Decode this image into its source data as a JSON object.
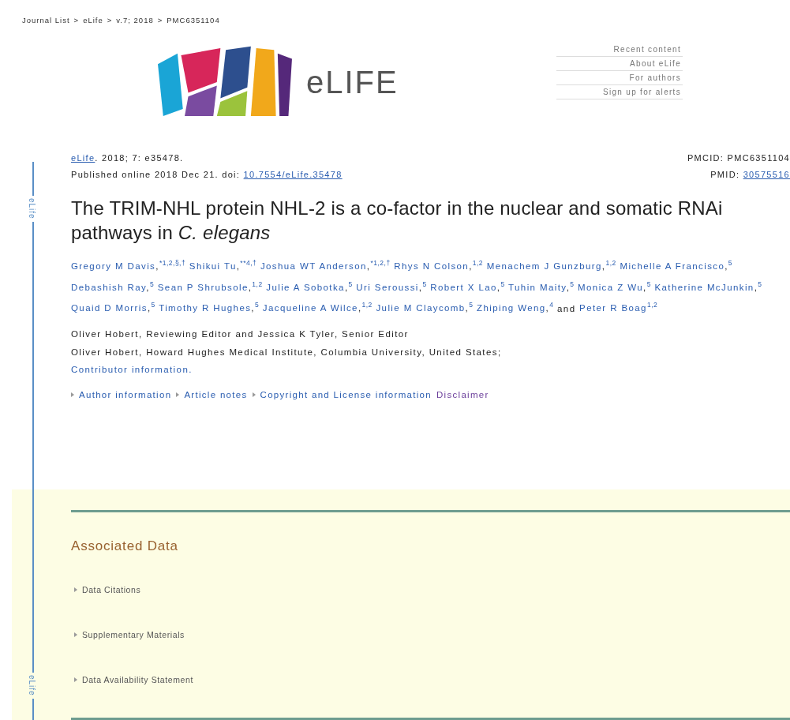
{
  "breadcrumb": [
    {
      "text": "Journal List",
      "sep": ">"
    },
    {
      "text": "eLife",
      "sep": ">"
    },
    {
      "text": "v.7; 2018",
      "sep": ">"
    },
    {
      "text": "PMC6351104"
    }
  ],
  "logo": {
    "text": "eLIFE"
  },
  "nav": [
    "Recent content",
    "About eLife",
    "For authors",
    "Sign up for alerts"
  ],
  "sidebar_label": [
    "eLife",
    "eLife"
  ],
  "citation": {
    "journal": "eLife",
    "rest": ". 2018; 7: e35478.",
    "published": "Published online 2018 Dec 21. doi: ",
    "doi": "10.7554/eLife.35478",
    "pmcid": "PMCID: PMC6351104",
    "pmid_label": "PMID: ",
    "pmid": "30575516"
  },
  "title": "The TRIM-NHL protein NHL-2 is a co-factor in the nuclear and somatic RNAi pathways in *C. elegans*",
  "authors": [
    {
      "name": "Gregory M Davis",
      "after": ",",
      "sup": "*1,2,§,†"
    },
    {
      "name": "Shikui Tu",
      "after": ",",
      "sup": "**4,†"
    },
    {
      "name": "Joshua WT Anderson",
      "after": ",",
      "sup": "*1,2,†"
    },
    {
      "name": "Rhys N Colson",
      "after": ",",
      "sup": "1,2"
    },
    {
      "name": "Menachem J Gunzburg",
      "after": ",",
      "sup": "1,2"
    },
    {
      "name": "Michelle A Francisco",
      "after": ",",
      "sup": "5"
    },
    {
      "name": "Debashish Ray",
      "after": ",",
      "sup": "5"
    },
    {
      "name": "Sean P Shrubsole",
      "after": ",",
      "sup": "1,2"
    },
    {
      "name": "Julie A Sobotka",
      "after": ",",
      "sup": "5"
    },
    {
      "name": "Uri Seroussi",
      "after": ",",
      "sup": "5"
    },
    {
      "name": "Robert X Lao",
      "after": ",",
      "sup": "5"
    },
    {
      "name": "Tuhin Maity",
      "after": ",",
      "sup": "5"
    },
    {
      "name": "Monica Z Wu",
      "after": ",",
      "sup": "5"
    },
    {
      "name": "Katherine McJunkin",
      "after": ",",
      "sup": "5"
    },
    {
      "name": "Quaid D Morris",
      "after": ",",
      "sup": "5"
    },
    {
      "name": "Timothy R Hughes",
      "after": ",",
      "sup": "5"
    },
    {
      "name": "Jacqueline A Wilce",
      "after": ",",
      "sup": "1,2"
    },
    {
      "name": "Julie M Claycomb",
      "after": ",",
      "sup": "5"
    },
    {
      "name": "Zhiping Weng",
      "after": ",",
      "sup": "4"
    },
    {
      "name": "Peter R Boag",
      "sup": "1,2",
      "prefix": "and"
    }
  ],
  "editors": [
    "Oliver Hobert, Reviewing Editor and Jessica K Tyler, Senior Editor",
    "Oliver Hobert, Howard Hughes Medical Institute, Columbia University, United States;"
  ],
  "contributor_link": "Contributor information.",
  "info_links": [
    "Author information",
    "Article notes",
    "Copyright and License information"
  ],
  "disclaimer": "Disclaimer",
  "associated_data": {
    "heading": "Associated Data",
    "items": [
      "Data Citations",
      "Supplementary Materials",
      "Data Availability Statement"
    ]
  }
}
